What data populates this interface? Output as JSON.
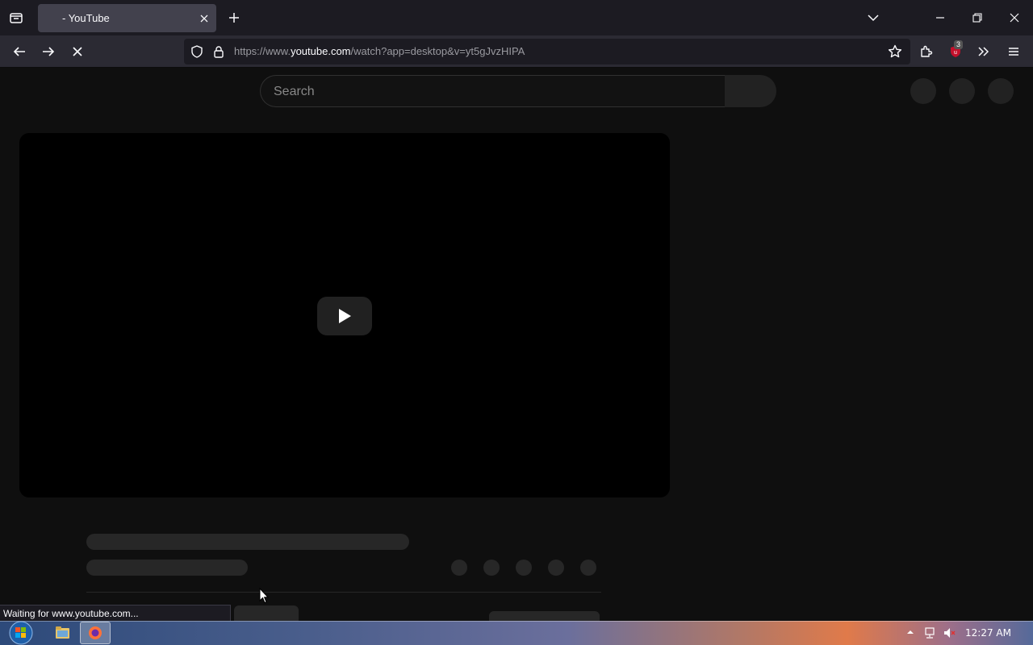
{
  "browser": {
    "tab_title": "- YouTube",
    "url_prefix": "https://www.",
    "url_domain": "youtube.com",
    "url_suffix": "/watch?app=desktop&v=yt5gJvzHIPA",
    "extension_badge": "3",
    "status_text": "Waiting for www.youtube.com..."
  },
  "youtube": {
    "search_placeholder": "Search"
  },
  "taskbar": {
    "time": "12:27 AM"
  },
  "colors": {
    "page_bg": "#0f0f0f",
    "skeleton": "#272727",
    "ublock_red": "#c4102b"
  }
}
